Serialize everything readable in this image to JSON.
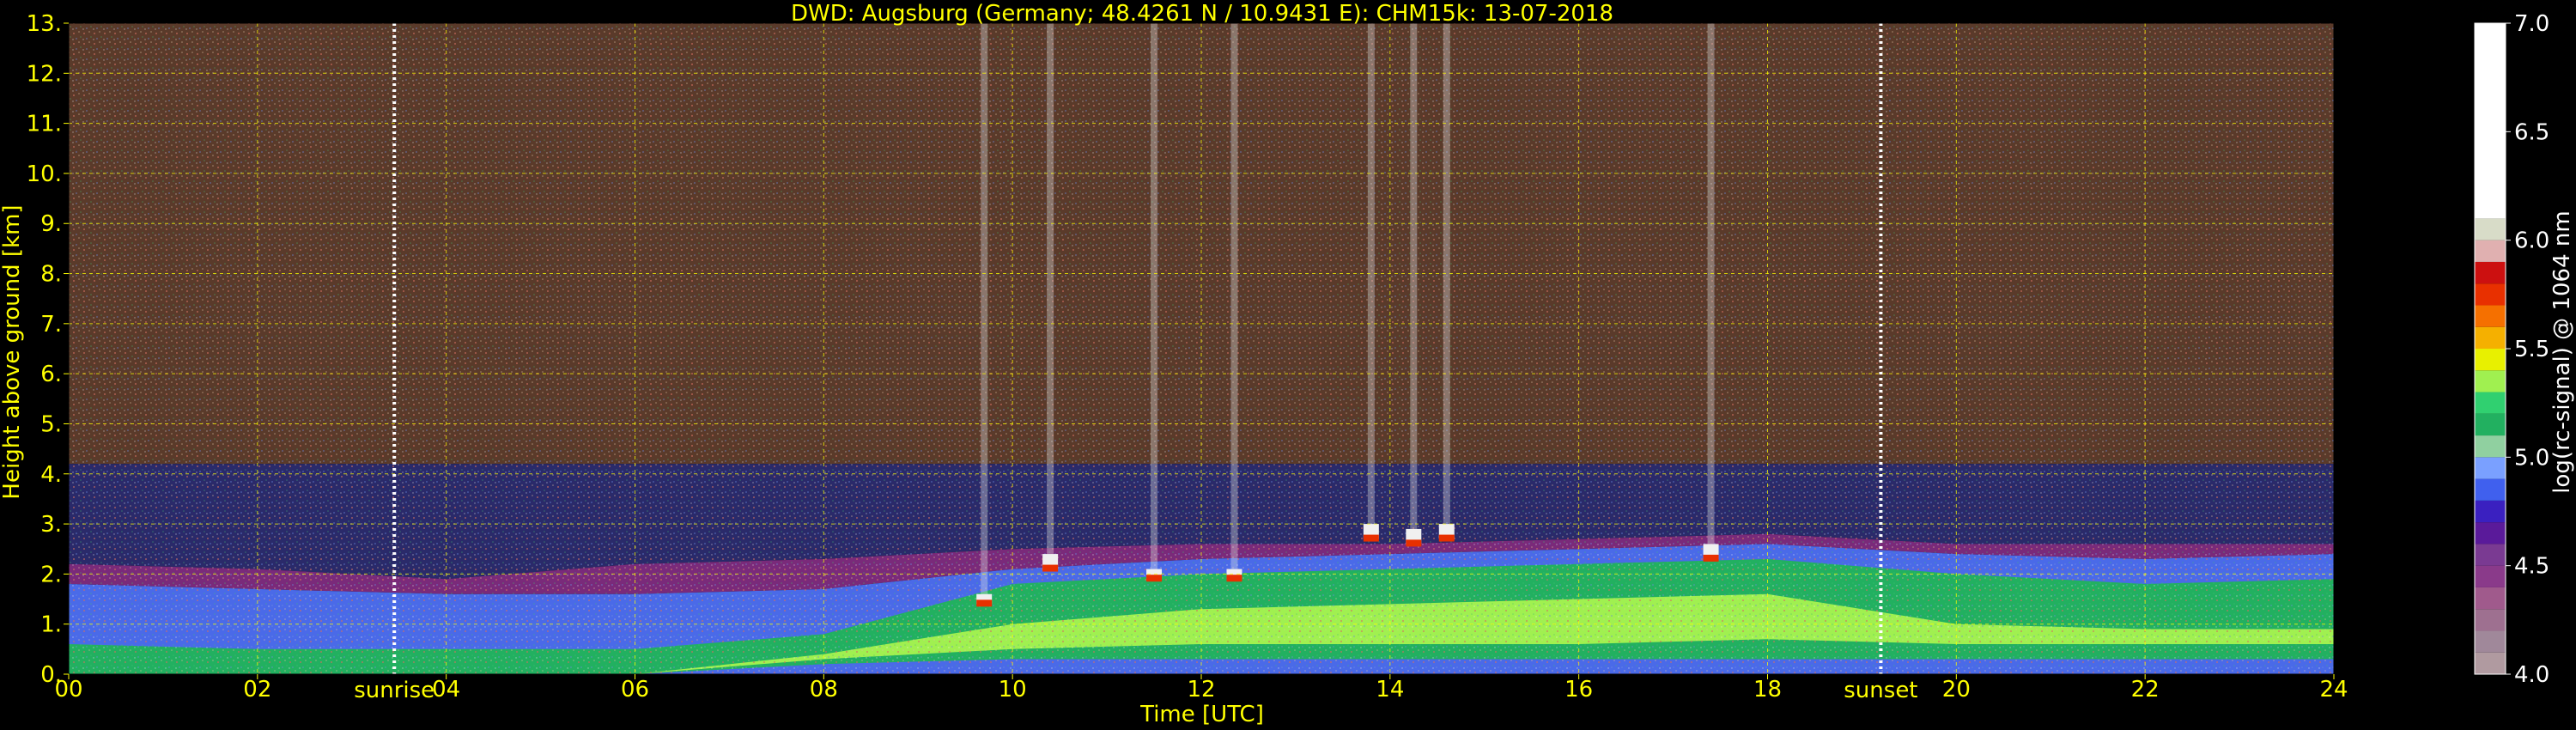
{
  "chart_data": {
    "type": "heatmap",
    "title": "DWD: Augsburg (Germany; 48.4261 N / 10.9431 E):    CHM15k: 13-07-2018",
    "xlabel": "Time [UTC]",
    "ylabel": "Height above ground [km]",
    "xlim": [
      0,
      24
    ],
    "ylim": [
      0,
      13
    ],
    "x_ticks": [
      {
        "value": 0,
        "label": "00"
      },
      {
        "value": 2,
        "label": "02"
      },
      {
        "value": 4,
        "label": "04"
      },
      {
        "value": 6,
        "label": "06"
      },
      {
        "value": 8,
        "label": "08"
      },
      {
        "value": 10,
        "label": "10"
      },
      {
        "value": 12,
        "label": "12"
      },
      {
        "value": 14,
        "label": "14"
      },
      {
        "value": 16,
        "label": "16"
      },
      {
        "value": 18,
        "label": "18"
      },
      {
        "value": 20,
        "label": "20"
      },
      {
        "value": 22,
        "label": "22"
      },
      {
        "value": 24,
        "label": "24"
      }
    ],
    "y_ticks": [
      {
        "value": 0,
        "label": "0."
      },
      {
        "value": 1,
        "label": "1."
      },
      {
        "value": 2,
        "label": "2."
      },
      {
        "value": 3,
        "label": "3."
      },
      {
        "value": 4,
        "label": "4."
      },
      {
        "value": 5,
        "label": "5."
      },
      {
        "value": 6,
        "label": "6."
      },
      {
        "value": 7,
        "label": "7."
      },
      {
        "value": 8,
        "label": "8."
      },
      {
        "value": 9,
        "label": "9."
      },
      {
        "value": 10,
        "label": "10."
      },
      {
        "value": 11,
        "label": "11."
      },
      {
        "value": 12,
        "label": "12."
      },
      {
        "value": 13,
        "label": "13."
      }
    ],
    "grid": true,
    "grid_color": "#ffff00",
    "background_color": "#000000",
    "markers": [
      {
        "name": "sunrise",
        "label": "sunrise",
        "x": 3.45
      },
      {
        "name": "sunset",
        "label": "sunset",
        "x": 19.2
      }
    ],
    "colorbar": {
      "label": "log(rc-signal) @ 1064 nm",
      "range": [
        4.0,
        7.0
      ],
      "ticks": [
        {
          "value": 4.0,
          "label": "4.0"
        },
        {
          "value": 4.5,
          "label": "4.5"
        },
        {
          "value": 5.0,
          "label": "5.0"
        },
        {
          "value": 5.5,
          "label": "5.5"
        },
        {
          "value": 6.0,
          "label": "6.0"
        },
        {
          "value": 6.5,
          "label": "6.5"
        },
        {
          "value": 7.0,
          "label": "7.0"
        }
      ],
      "bands": [
        {
          "from": 4.0,
          "to": 4.1,
          "color": "#b09aa0"
        },
        {
          "from": 4.1,
          "to": 4.2,
          "color": "#a0889a"
        },
        {
          "from": 4.2,
          "to": 4.3,
          "color": "#9e7090"
        },
        {
          "from": 4.3,
          "to": 4.4,
          "color": "#a05a8c"
        },
        {
          "from": 4.4,
          "to": 4.5,
          "color": "#8a3a8a"
        },
        {
          "from": 4.5,
          "to": 4.6,
          "color": "#7a3a92"
        },
        {
          "from": 4.6,
          "to": 4.7,
          "color": "#5a1a9a"
        },
        {
          "from": 4.7,
          "to": 4.8,
          "color": "#3a20c0"
        },
        {
          "from": 4.8,
          "to": 4.9,
          "color": "#4060ee"
        },
        {
          "from": 4.9,
          "to": 5.0,
          "color": "#7aa0ff"
        },
        {
          "from": 5.0,
          "to": 5.1,
          "color": "#90d0a0"
        },
        {
          "from": 5.1,
          "to": 5.2,
          "color": "#22b060"
        },
        {
          "from": 5.2,
          "to": 5.3,
          "color": "#30d070"
        },
        {
          "from": 5.3,
          "to": 5.4,
          "color": "#a0f050"
        },
        {
          "from": 5.4,
          "to": 5.5,
          "color": "#e8f000"
        },
        {
          "from": 5.5,
          "to": 5.6,
          "color": "#f5b000"
        },
        {
          "from": 5.6,
          "to": 5.7,
          "color": "#f57000"
        },
        {
          "from": 5.7,
          "to": 5.8,
          "color": "#e83000"
        },
        {
          "from": 5.8,
          "to": 5.9,
          "color": "#cc1010"
        },
        {
          "from": 5.9,
          "to": 6.0,
          "color": "#e0b0b0"
        },
        {
          "from": 6.0,
          "to": 6.1,
          "color": "#d8dcc8"
        },
        {
          "from": 6.1,
          "to": 7.0,
          "color": "#ffffff"
        }
      ]
    },
    "layers": [
      {
        "name": "upper-noise",
        "bottom_km": [
          4.2,
          4.2,
          4.2,
          4.2,
          4.2,
          4.2,
          4.2,
          4.2,
          4.2,
          4.2,
          4.2,
          4.2,
          4.2
        ],
        "top_km": [
          13,
          13,
          13,
          13,
          13,
          13,
          13,
          13,
          13,
          13,
          13,
          13,
          13
        ],
        "color": "#5a3a2a"
      },
      {
        "name": "mid-noise",
        "bottom_km": [
          2.2,
          2.1,
          1.9,
          2.2,
          2.3,
          2.5,
          2.6,
          2.6,
          2.7,
          2.8,
          2.6,
          2.6,
          2.6
        ],
        "top_km": [
          4.2,
          4.2,
          4.2,
          4.2,
          4.2,
          4.2,
          4.2,
          4.2,
          4.2,
          4.2,
          4.2,
          4.2,
          4.2
        ],
        "color": "#2a2a6a"
      },
      {
        "name": "residual-layer-top",
        "bottom_km": [
          1.8,
          1.7,
          1.6,
          1.6,
          1.7,
          2.1,
          2.3,
          2.4,
          2.5,
          2.6,
          2.4,
          2.3,
          2.4
        ],
        "top_km": [
          2.2,
          2.1,
          1.9,
          2.2,
          2.3,
          2.5,
          2.6,
          2.6,
          2.7,
          2.8,
          2.6,
          2.6,
          2.6
        ],
        "color": "#7a2a7a"
      },
      {
        "name": "night-boundary-layer",
        "bottom_km": [
          0,
          0,
          0,
          0,
          0,
          0,
          0,
          0,
          0,
          0,
          0,
          0,
          0
        ],
        "top_km": [
          1.8,
          1.7,
          1.6,
          1.6,
          1.7,
          2.1,
          2.3,
          2.4,
          2.5,
          2.6,
          2.4,
          2.3,
          2.4
        ],
        "color": "#4a6ae8"
      },
      {
        "name": "mixing-layer",
        "bottom_km": [
          0,
          0,
          0,
          0,
          0.2,
          0.3,
          0.3,
          0.3,
          0.3,
          0.3,
          0.3,
          0.3,
          0.3
        ],
        "top_km": [
          0.6,
          0.5,
          0.5,
          0.5,
          0.8,
          1.8,
          2.0,
          2.1,
          2.2,
          2.3,
          2.0,
          1.8,
          1.9
        ],
        "color": "#22b060"
      },
      {
        "name": "aerosol-core",
        "bottom_km": [
          0,
          0,
          0,
          0,
          0.3,
          0.5,
          0.6,
          0.6,
          0.6,
          0.7,
          0.6,
          0.6,
          0.6
        ],
        "top_km": [
          0,
          0,
          0,
          0,
          0.4,
          1.0,
          1.3,
          1.4,
          1.5,
          1.6,
          1.0,
          0.9,
          0.9
        ],
        "color": "#a0f050"
      }
    ],
    "layer_x": [
      0,
      2,
      4,
      6,
      8,
      10,
      12,
      14,
      16,
      18,
      20,
      22,
      24
    ],
    "clouds": [
      {
        "x": 9.7,
        "base_km": 1.4,
        "top_km": 1.6
      },
      {
        "x": 10.4,
        "base_km": 2.1,
        "top_km": 2.4
      },
      {
        "x": 11.5,
        "base_km": 1.9,
        "top_km": 2.1
      },
      {
        "x": 12.35,
        "base_km": 1.9,
        "top_km": 2.1
      },
      {
        "x": 13.8,
        "base_km": 2.7,
        "top_km": 3.0
      },
      {
        "x": 14.25,
        "base_km": 2.6,
        "top_km": 2.9
      },
      {
        "x": 14.6,
        "base_km": 2.7,
        "top_km": 3.0
      },
      {
        "x": 17.4,
        "base_km": 2.3,
        "top_km": 2.6
      }
    ]
  }
}
